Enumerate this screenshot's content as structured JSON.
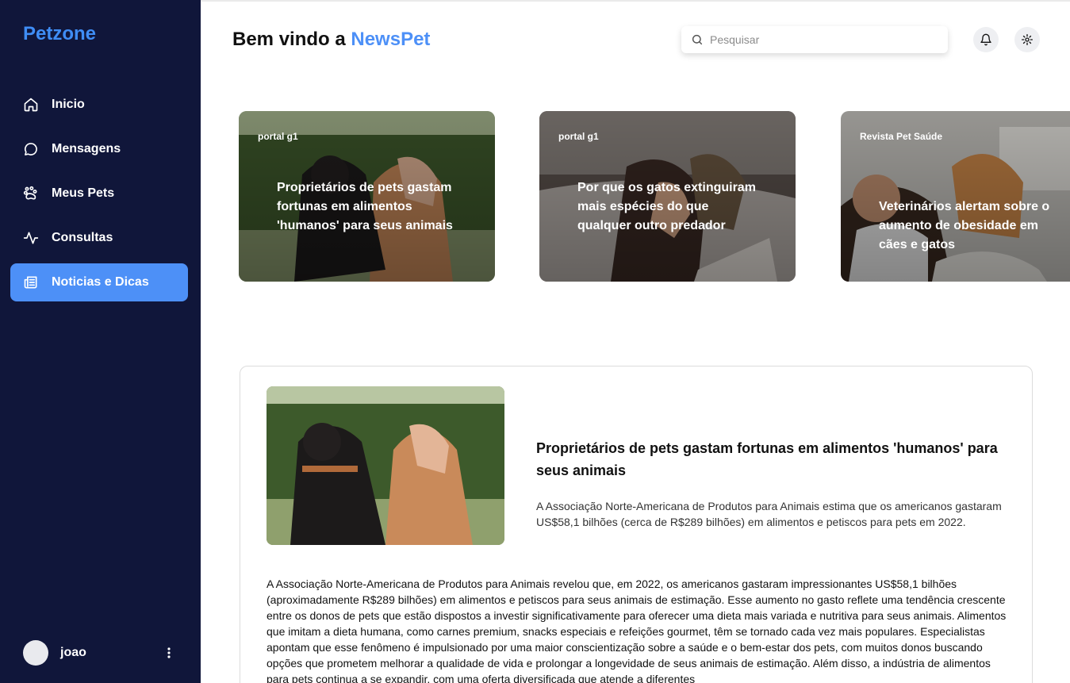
{
  "app": {
    "brand": "Petzone"
  },
  "sidebar": {
    "items": [
      {
        "label": "Inicio",
        "icon": "home-icon",
        "active": false
      },
      {
        "label": "Mensagens",
        "icon": "message-icon",
        "active": false
      },
      {
        "label": "Meus Pets",
        "icon": "paw-icon",
        "active": false
      },
      {
        "label": "Consultas",
        "icon": "activity-icon",
        "active": false
      },
      {
        "label": "Noticias e Dicas",
        "icon": "newspaper-icon",
        "active": true
      }
    ],
    "user": {
      "name": "joao"
    }
  },
  "header": {
    "greeting": "Bem vindo a",
    "greeting_accent": "NewsPet",
    "search_placeholder": "Pesquisar"
  },
  "cards": [
    {
      "source": "portal g1",
      "title": "Proprietários de pets gastam fortunas em alimentos 'humanos' para seus animais"
    },
    {
      "source": "portal g1",
      "title": "Por que os gatos extinguiram mais espécies do que qualquer outro predador"
    },
    {
      "source": "Revista Pet Saúde",
      "title": "Veterinários alertam sobre o aumento de obesidade em cães e gatos"
    }
  ],
  "article": {
    "title": "Proprietários de pets gastam fortunas em alimentos 'humanos' para seus animais",
    "summary": "A Associação Norte-Americana de Produtos para Animais estima que os americanos gastaram US$58,1 bilhões (cerca de R$289 bilhões) em alimentos e petiscos para pets em 2022.",
    "body": "A Associação Norte-Americana de Produtos para Animais revelou que, em 2022, os americanos gastaram impressionantes US$58,1 bilhões (aproximadamente R$289 bilhões) em alimentos e petiscos para seus animais de estimação. Esse aumento no gasto reflete uma tendência crescente entre os donos de pets que estão dispostos a investir significativamente para oferecer uma dieta mais variada e nutritiva para seus animais. Alimentos que imitam a dieta humana, como carnes premium, snacks especiais e refeições gourmet, têm se tornado cada vez mais populares. Especialistas apontam que esse fenômeno é impulsionado por uma maior conscientização sobre a saúde e o bem-estar dos pets, com muitos donos buscando opções que prometem melhorar a qualidade de vida e prolongar a longevidade de seus animais de estimação. Além disso, a indústria de alimentos para pets continua a se expandir, com uma oferta diversificada que atende a diferentes"
  },
  "colors": {
    "sidebar_bg": "#10163a",
    "accent": "#4d90f7",
    "brand": "#3f8df5"
  }
}
